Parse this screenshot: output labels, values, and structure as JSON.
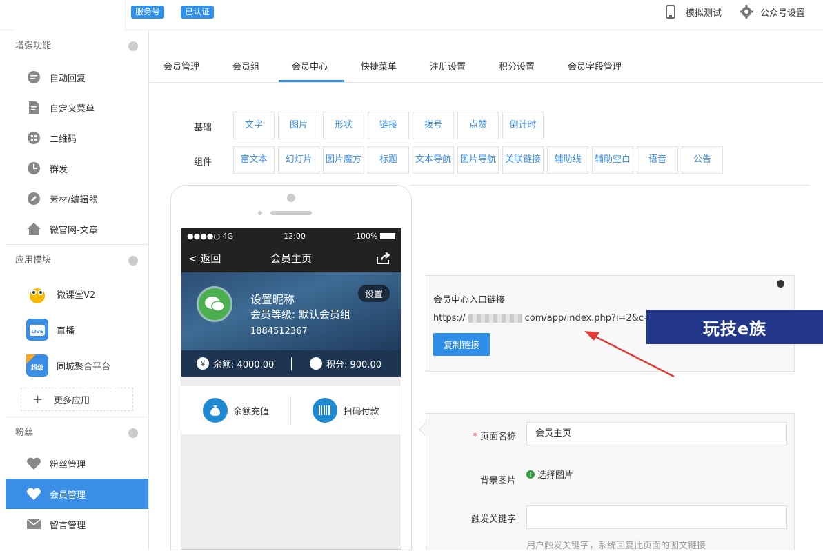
{
  "header": {
    "badge_service": "服务号",
    "badge_verified": "已认证",
    "simulate": "模拟测试",
    "settings": "公众号设置"
  },
  "sidebar": {
    "sections": [
      {
        "title": "增强功能",
        "items": [
          "自动回复",
          "自定义菜单",
          "二维码",
          "群发",
          "素材/编辑器",
          "微官网-文章"
        ]
      },
      {
        "title": "应用模块",
        "items": [
          "微课堂V2",
          "直播",
          "同城聚合平台"
        ],
        "more": "更多应用"
      },
      {
        "title": "粉丝",
        "items": [
          "粉丝管理",
          "会员管理",
          "留言管理"
        ]
      }
    ]
  },
  "tabs": [
    "会员管理",
    "会员组",
    "会员中心",
    "快捷菜单",
    "注册设置",
    "积分设置",
    "会员字段管理"
  ],
  "components": {
    "basic_label": "基础",
    "basic": [
      "文字",
      "图片",
      "形状",
      "链接",
      "拨号",
      "点赞",
      "倒计时"
    ],
    "widget_label": "组件",
    "widgets": [
      "富文本",
      "幻灯片",
      "图片魔方",
      "标题",
      "文本导航",
      "图片导航",
      "关联链接",
      "辅助线",
      "辅助空白",
      "语音",
      "公告"
    ]
  },
  "phone": {
    "signal": "●●●●○ 4G",
    "time": "12:00",
    "battery": "100%",
    "back": "返回",
    "title": "会员主页",
    "nickname": "设置昵称",
    "level": "会员等级: 默认会员组",
    "phone_number": "18845123​67",
    "settings_btn": "设置",
    "balance": "余额: 4000.00",
    "points": "积分: 900.00",
    "action_recharge": "余额充值",
    "action_scan": "扫码付款"
  },
  "link_panel": {
    "title": "会员中心入口链接",
    "url_prefix": "https://",
    "url_rest": "com/app/index.php?i=2&c=m",
    "copy": "复制链接"
  },
  "watermark": "玩技e族",
  "form": {
    "required_mark": "*",
    "page_name_label": "页面名称",
    "page_name_value": "会员主页",
    "bg_label": "背景图片",
    "bg_select": "选择图片",
    "keyword_label": "触发关键字",
    "keyword_value": "",
    "keyword_hint": "用户触发关键字，系统回复此页面的图文链接"
  },
  "colors": {
    "accent": "#2f8ee5",
    "active_nav": "#3b8ee6"
  }
}
